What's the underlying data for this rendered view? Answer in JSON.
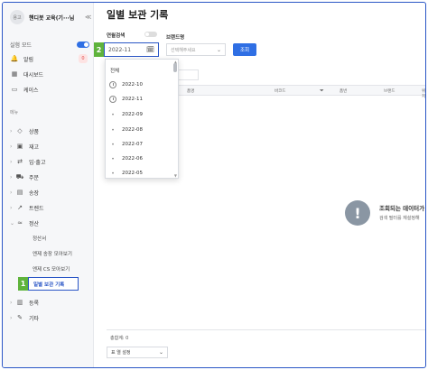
{
  "sidebar": {
    "avatar_text": "용고",
    "brand_name": "핸디봇 교육(기···님",
    "collapse_glyph": "≪",
    "mode_label": "실험 모드",
    "alarm_label": "알림",
    "alarm_count": "0",
    "dashboard_label": "대시보드",
    "case_label": "케이스",
    "menu_heading": "메뉴",
    "items": [
      {
        "label": "상품"
      },
      {
        "label": "재고"
      },
      {
        "label": "입·출고"
      },
      {
        "label": "주문"
      },
      {
        "label": "송장"
      },
      {
        "label": "트렌드"
      },
      {
        "label": "정산"
      }
    ],
    "sub_items": [
      {
        "label": "정산서"
      },
      {
        "label": "엔제 송장 모아보기"
      },
      {
        "label": "엔제 CS 모아보기"
      }
    ],
    "active_item": "일별 보관 기록",
    "after_items": [
      {
        "label": "등록"
      },
      {
        "label": "기타"
      }
    ],
    "step1": "1"
  },
  "main": {
    "title": "일별 보관 기록",
    "month_search_label": "연월검색",
    "brand_label": "브랜드명",
    "date_value": "2022-11",
    "brand_placeholder": "선택해주세요",
    "search_button": "조회",
    "step2": "2",
    "table_headers": {
      "name": "품명",
      "barcode": "바코드",
      "item": "품번",
      "brand": "브랜드",
      "location": "위치"
    },
    "empty_title": "조회되는 데이터가",
    "empty_sub": "검색 필터를 재설정해",
    "total_label": "총합계: 0",
    "rows_select": "표 열 설정"
  },
  "dropdown": {
    "all_label": "전체",
    "recent": [
      "2022-10",
      "2022-11"
    ],
    "months": [
      "2022-09",
      "2022-08",
      "2022-07",
      "2022-06",
      "2022-05"
    ]
  }
}
